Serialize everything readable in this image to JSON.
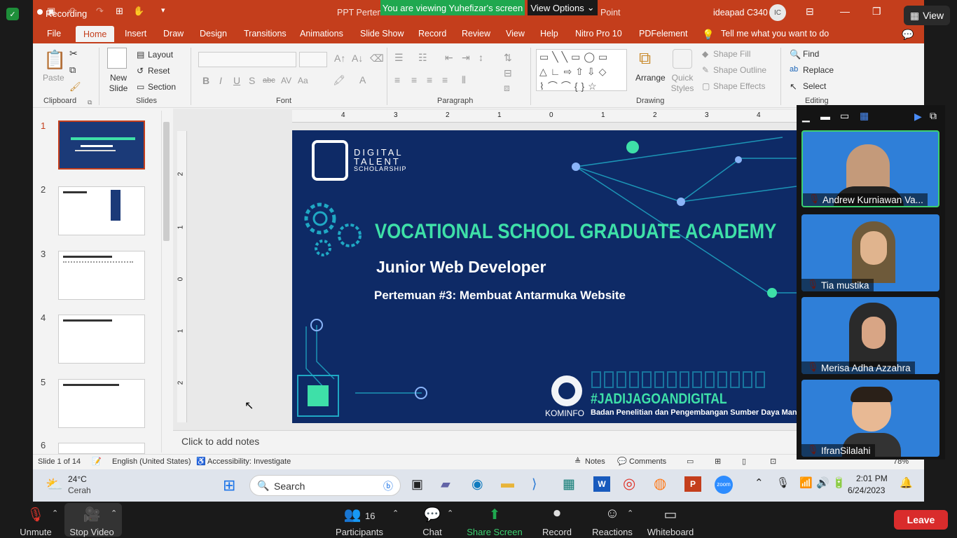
{
  "zoom": {
    "recording_label": "Recording",
    "share_banner": "You are viewing Yuhefizar's screen",
    "view_options": "View Options",
    "view_button": "View",
    "toolbar": {
      "unmute": "Unmute",
      "stop_video": "Stop Video",
      "participants": "Participants",
      "participants_count": "16",
      "chat": "Chat",
      "share_screen": "Share Screen",
      "record": "Record",
      "reactions": "Reactions",
      "whiteboard": "Whiteboard",
      "leave": "Leave"
    },
    "participants": [
      {
        "name": "Andrew Kurniawan Va..."
      },
      {
        "name": "Tia mustika"
      },
      {
        "name": "Merisa Adha Azzahra"
      },
      {
        "name": "IfranSilalahi"
      }
    ]
  },
  "ppt": {
    "title_left": "PPT Pertemu",
    "title_right": "Point",
    "user": "ideapad C340",
    "user_initials": "IC",
    "tabs": [
      "File",
      "Home",
      "Insert",
      "Draw",
      "Design",
      "Transitions",
      "Animations",
      "Slide Show",
      "Record",
      "Review",
      "View",
      "Help",
      "Nitro Pro 10",
      "PDFelement"
    ],
    "tell_me": "Tell me what you want to do",
    "ribbon": {
      "paste": "Paste",
      "clipboard": "Clipboard",
      "new_slide": "New Slide",
      "layout": "Layout",
      "reset": "Reset",
      "section": "Section",
      "slides": "Slides",
      "font": "Font",
      "paragraph": "Paragraph",
      "arrange": "Arrange",
      "quick_styles": "Quick Styles",
      "shape_fill": "Shape Fill",
      "shape_outline": "Shape Outline",
      "shape_effects": "Shape Effects",
      "drawing": "Drawing",
      "find": "Find",
      "replace": "Replace",
      "select": "Select",
      "editing": "Editing"
    },
    "thumb_numbers": [
      "1",
      "2",
      "3",
      "4",
      "5",
      "6"
    ],
    "notes_placeholder": "Click to add notes",
    "status": {
      "slide": "Slide 1 of 14",
      "language": "English (United States)",
      "accessibility": "Accessibility: Investigate",
      "notes": "Notes",
      "comments": "Comments",
      "zoom": "78%"
    },
    "slide": {
      "logo_line1": "DIGITAL",
      "logo_line2": "TALENT",
      "logo_line3": "SCHOLARSHIP",
      "title": "VOCATIONAL SCHOOL GRADUATE ACADEMY",
      "subtitle": "Junior Web Developer",
      "meeting": "Pertemuan #3: Membuat Antarmuka Website",
      "hashtag": "#JADIJAGOANDIGITAL",
      "agency": "Badan Penelitian dan Pengembangan Sumber Daya Manusia",
      "kominfo": "KOMINFO"
    },
    "ruler_top": [
      "4",
      "3",
      "2",
      "1",
      "0",
      "1",
      "2",
      "3",
      "4"
    ],
    "ruler_left": [
      "2",
      "1",
      "0",
      "1",
      "2"
    ]
  },
  "taskbar": {
    "temp": "24°C",
    "weather": "Cerah",
    "search": "Search",
    "time": "2:01 PM",
    "date": "6/24/2023"
  },
  "colors": {
    "ppt_accent": "#c43e1c",
    "slide_bg": "#0e2a66",
    "slide_title": "#3ee0a8",
    "zoom_green": "#1fa84f",
    "leave_red": "#d92c2c"
  }
}
